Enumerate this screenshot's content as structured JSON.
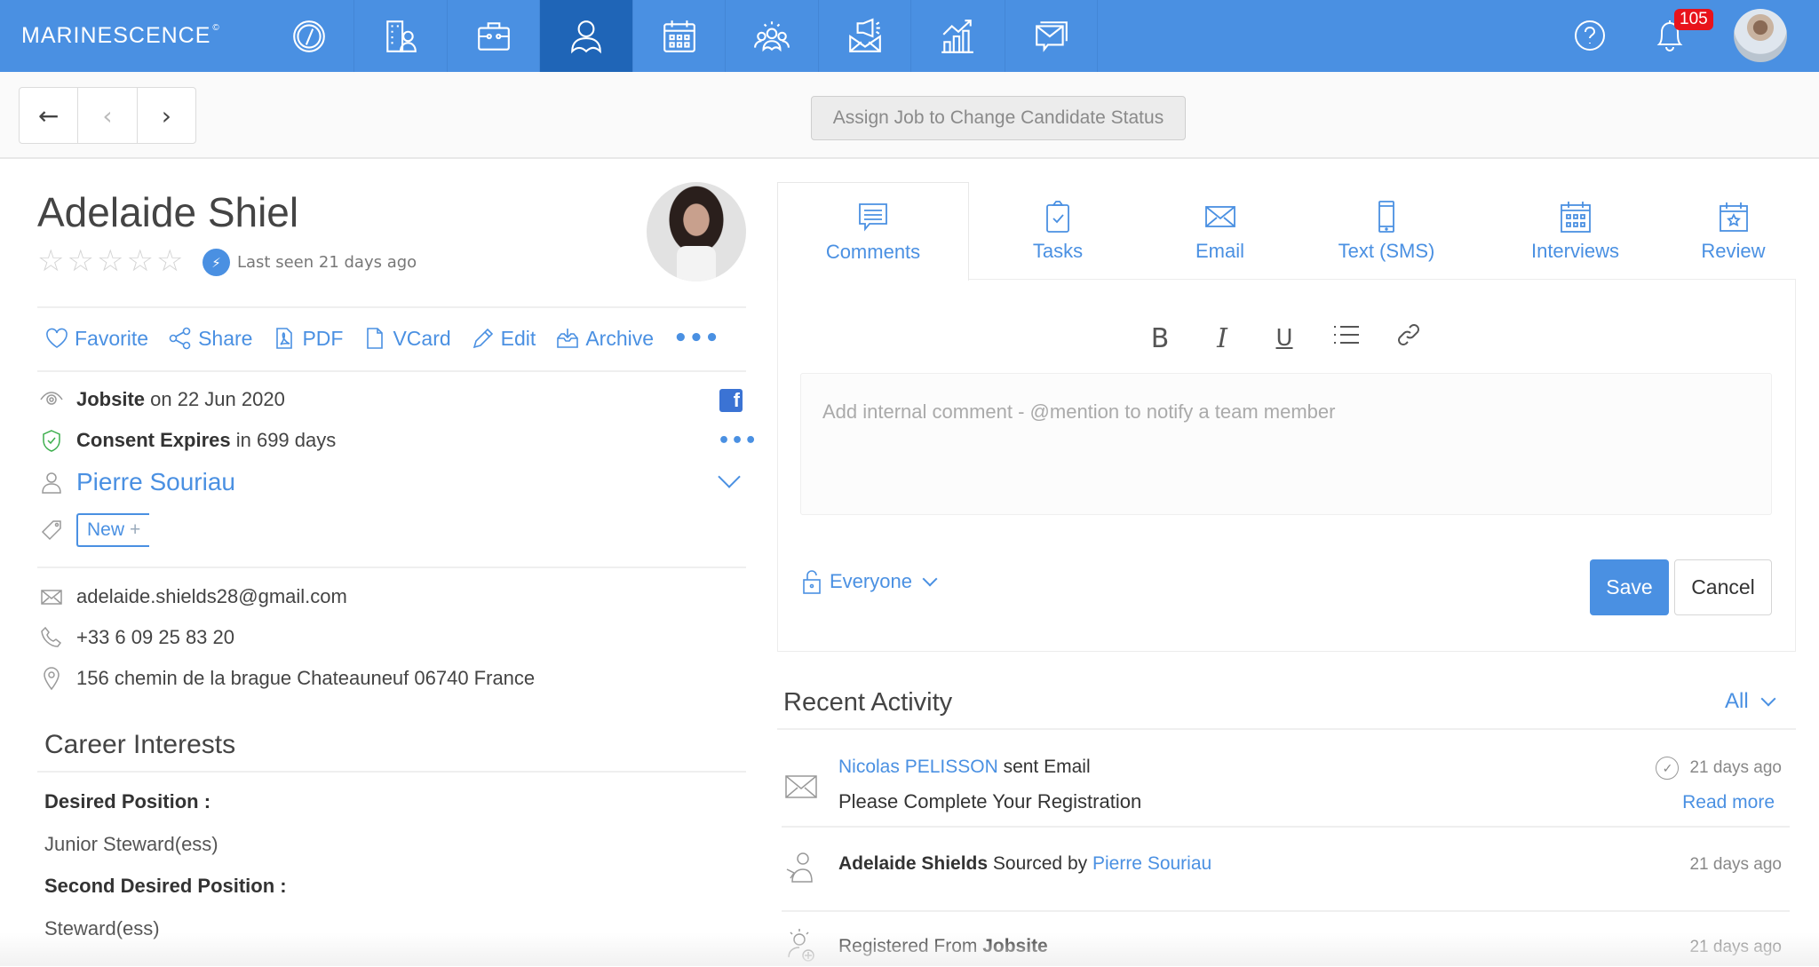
{
  "topbar": {
    "logo": "MARINESCENCE",
    "logo_mark": "©",
    "nav": [
      {
        "name": "dashboard",
        "icon": "speedometer-icon"
      },
      {
        "name": "companies",
        "icon": "building-contact-icon"
      },
      {
        "name": "jobs",
        "icon": "briefcase-icon"
      },
      {
        "name": "candidates",
        "icon": "person-icon",
        "active": true
      },
      {
        "name": "calendar",
        "icon": "calendar-icon"
      },
      {
        "name": "team",
        "icon": "team-icon"
      },
      {
        "name": "campaigns",
        "icon": "megaphone-mail-icon"
      },
      {
        "name": "reports",
        "icon": "growth-chart-icon"
      },
      {
        "name": "messages",
        "icon": "mail-chat-icon"
      }
    ],
    "notifications_count": "105",
    "accent_color": "#4a90e2",
    "active_color": "#1f65b7"
  },
  "subbar": {
    "back_label": "←",
    "prev_label": "‹",
    "next_label": "›",
    "assign_button": "Assign Job to Change Candidate Status"
  },
  "candidate": {
    "name": "Adelaide Shiel",
    "rating": 0,
    "rating_max": 5,
    "last_seen": "Last seen 21 days ago",
    "actions": [
      {
        "label": "Favorite",
        "icon": "heart-icon"
      },
      {
        "label": "Share",
        "icon": "share-icon"
      },
      {
        "label": "PDF",
        "icon": "pdf-icon"
      },
      {
        "label": "VCard",
        "icon": "document-icon"
      },
      {
        "label": "Edit",
        "icon": "pencil-icon"
      },
      {
        "label": "Archive",
        "icon": "archive-icon"
      }
    ],
    "more_label": "•••",
    "source_bold": "Jobsite",
    "source_rest": " on 22 Jun 2020",
    "consent_bold": "Consent Expires",
    "consent_rest": " in 699 days",
    "consent_more": "•••",
    "owner": "Pierre Souriau",
    "tag_label": "New",
    "tag_plus": "+",
    "facebook_letter": "f",
    "email": "adelaide.shields28@gmail.com",
    "phone": "+33 6 09 25 83 20",
    "address": "156 chemin de la brague Chateauneuf 06740 France"
  },
  "career": {
    "title": "Career Interests",
    "fields": [
      {
        "label": "Desired Position :",
        "value": "Junior Steward(ess)"
      },
      {
        "label": "Second Desired Position :",
        "value": "Steward(ess)"
      }
    ]
  },
  "tabs": [
    {
      "label": "Comments",
      "icon": "comment-icon",
      "active": true
    },
    {
      "label": "Tasks",
      "icon": "clipboard-check-icon"
    },
    {
      "label": "Email",
      "icon": "envelope-icon"
    },
    {
      "label": "Text (SMS)",
      "icon": "phone-icon"
    },
    {
      "label": "Interviews",
      "icon": "calendar-grid-icon"
    },
    {
      "label": "Review",
      "icon": "calendar-star-icon"
    }
  ],
  "editor": {
    "toolbar": {
      "bold": "B",
      "italic": "I",
      "underline": "U"
    },
    "placeholder": "Add internal comment - @mention to notify a team member",
    "visibility": "Everyone",
    "save": "Save",
    "cancel": "Cancel"
  },
  "activity": {
    "title": "Recent Activity",
    "filter": "All",
    "items": [
      {
        "actor": "Nicolas PELISSON",
        "text": " sent Email",
        "subject": "Please Complete Your Registration",
        "time": "21 days ago",
        "read_more": "Read more"
      },
      {
        "actor": "Adelaide Shields",
        "text": " Sourced by ",
        "link": "Pierre Souriau",
        "time": "21 days ago"
      },
      {
        "text": "Registered From ",
        "bold": "Jobsite",
        "time": "21 days ago"
      }
    ]
  }
}
